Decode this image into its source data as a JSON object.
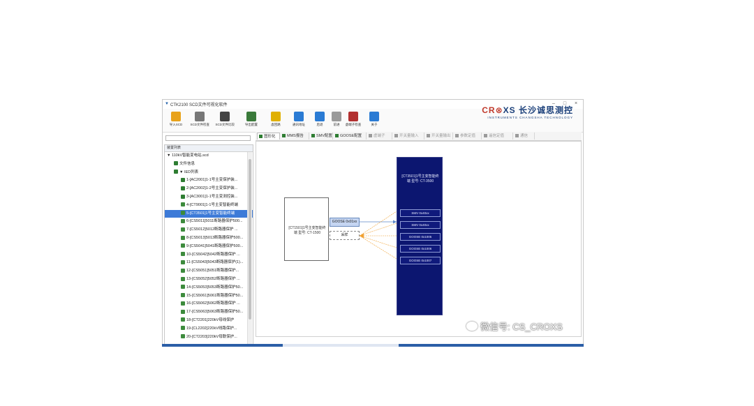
{
  "window": {
    "title": "CTK2100 SCD文件可视化软件",
    "minimize": "–",
    "maximize": "□",
    "close": "×"
  },
  "toolbar": {
    "items": [
      {
        "label": "导入SCD",
        "icon": "import-icon",
        "color": "#e8a21a"
      },
      {
        "label": "SCD文件检查",
        "icon": "check-icon",
        "color": "#777777"
      },
      {
        "label": "SCD文件比较",
        "icon": "compare-icon",
        "color": "#444444"
      },
      {
        "label": "导出配置",
        "icon": "export-icon",
        "color": "#3a7a3a"
      },
      {
        "label": "虚回路",
        "icon": "circuit-icon",
        "color": "#e0b000"
      },
      {
        "label": "通讯地址",
        "icon": "network-icon",
        "color": "#2a7bd4"
      },
      {
        "label": "后退",
        "icon": "back-icon",
        "color": "#2a7bd4"
      },
      {
        "label": "前进",
        "icon": "forward-icon",
        "color": "#9a9a9a"
      },
      {
        "label": "虚端子检查",
        "icon": "bug-icon",
        "color": "#b23030"
      },
      {
        "label": "关于",
        "icon": "info-icon",
        "color": "#2a7bd4"
      }
    ]
  },
  "brand": {
    "name_prefix": "CR",
    "name_mid": "⊗",
    "name_suffix": "XS 长沙诚思测控",
    "tagline": "INSTRUMENTS CHANGSHA TECHNOLOGY"
  },
  "sidebar": {
    "search_value": "",
    "header": "装置列表",
    "items": [
      {
        "label": "▼ 110kV智能变电站.scd",
        "indent": 0,
        "icon_color": "",
        "selected": false
      },
      {
        "label": "文件信息",
        "indent": 1,
        "icon_color": "#2e7d32",
        "selected": false
      },
      {
        "label": "▼ IED列表",
        "indent": 1,
        "icon_color": "#2e7d32",
        "selected": false
      },
      {
        "label": "1-[AC2001]1-1号主变保护装...",
        "indent": 2,
        "icon_color": "#2e7d32",
        "selected": false
      },
      {
        "label": "2-[AC2002]1-2号主变保护装...",
        "indent": 2,
        "icon_color": "#2e7d32",
        "selected": false
      },
      {
        "label": "3-[AC3001]1-1号主变测控装...",
        "indent": 2,
        "icon_color": "#2e7d32",
        "selected": false
      },
      {
        "label": "4-[CT9001]1-1号主变智能终端",
        "indent": 2,
        "icon_color": "#3d8b3d",
        "selected": false
      },
      {
        "label": "5-[CT3501]1号主变智能终端",
        "indent": 2,
        "icon_color": "#3d8b3d",
        "selected": true
      },
      {
        "label": "6-[CS5011]5011断路器保护500...",
        "indent": 2,
        "icon_color": "#3d8b3d",
        "selected": false
      },
      {
        "label": "7-[CS5012]5012断路器保护 ...",
        "indent": 2,
        "icon_color": "#3d8b3d",
        "selected": false
      },
      {
        "label": "8-[CS5013]5013断路器保护500...",
        "indent": 2,
        "icon_color": "#3d8b3d",
        "selected": false
      },
      {
        "label": "9-[CS5041]5041断路器保护500...",
        "indent": 2,
        "icon_color": "#3d8b3d",
        "selected": false
      },
      {
        "label": "10-[CS5042]5042断路器保护 ...",
        "indent": 2,
        "icon_color": "#3d8b3d",
        "selected": false
      },
      {
        "label": "11-[CS5043]5043断路器保护(1)...",
        "indent": 2,
        "icon_color": "#3d8b3d",
        "selected": false
      },
      {
        "label": "12-[CS5051]5051断路器保护...",
        "indent": 2,
        "icon_color": "#3d8b3d",
        "selected": false
      },
      {
        "label": "13-[CS5052]5052断路器保护 ...",
        "indent": 2,
        "icon_color": "#3d8b3d",
        "selected": false
      },
      {
        "label": "14-[CS5053]5053断路器保护50...",
        "indent": 2,
        "icon_color": "#3d8b3d",
        "selected": false
      },
      {
        "label": "15-[CS5061]5061断路器保护50...",
        "indent": 2,
        "icon_color": "#3d8b3d",
        "selected": false
      },
      {
        "label": "16-[CS5062]5062断路器保护 ...",
        "indent": 2,
        "icon_color": "#3d8b3d",
        "selected": false
      },
      {
        "label": "17-[CS5063]5063断路器保护50...",
        "indent": 2,
        "icon_color": "#3d8b3d",
        "selected": false
      },
      {
        "label": "18-[CT2201]220kV母线保护",
        "indent": 2,
        "icon_color": "#3d8b3d",
        "selected": false
      },
      {
        "label": "19-[CL2202]220kV线路保护...",
        "indent": 2,
        "icon_color": "#3d8b3d",
        "selected": false
      },
      {
        "label": "20-[CT2203]220kV母联保护...",
        "indent": 2,
        "icon_color": "#3d8b3d",
        "selected": false
      }
    ]
  },
  "tabs": [
    {
      "label": "图形化",
      "active": true,
      "dim": false,
      "icon_color": "#2e7d32"
    },
    {
      "label": "MMS报告",
      "active": false,
      "dim": false,
      "icon_color": "#2e7d32"
    },
    {
      "label": "SMV配置",
      "active": false,
      "dim": false,
      "icon_color": "#2e7d32"
    },
    {
      "label": "GOOSE配置",
      "active": false,
      "dim": false,
      "icon_color": "#2e7d32"
    },
    {
      "label": "虚端子",
      "active": false,
      "dim": true,
      "icon_color": "#9a9a9a"
    },
    {
      "label": "开关量输入",
      "active": false,
      "dim": true,
      "icon_color": "#9a9a9a"
    },
    {
      "label": "开关量输出",
      "active": false,
      "dim": true,
      "icon_color": "#9a9a9a"
    },
    {
      "label": "参数定值",
      "active": false,
      "dim": true,
      "icon_color": "#9a9a9a"
    },
    {
      "label": "遥信定值",
      "active": false,
      "dim": true,
      "icon_color": "#9a9a9a"
    },
    {
      "label": "通信",
      "active": false,
      "dim": true,
      "icon_color": "#9a9a9a"
    }
  ],
  "diagram": {
    "left_node": "[CT1501]1号主变智能终端 型号: CT-1500",
    "port_goose": "GOOSE 0x01xx",
    "port_sample": "采样",
    "right_node_title": "[CT3501]1号主变智能终端 型号: CT-3500",
    "right_ports": [
      "SMV 0x40xx",
      "SMV 0x40xx",
      "GOOSE 0x1005",
      "GOOSE 0x1006",
      "GOOSE 0x1007"
    ],
    "link_colors": {
      "goose": "#5e86c8",
      "sample": "#f0a030"
    }
  },
  "watermark": "微信号: CS_CROXS"
}
